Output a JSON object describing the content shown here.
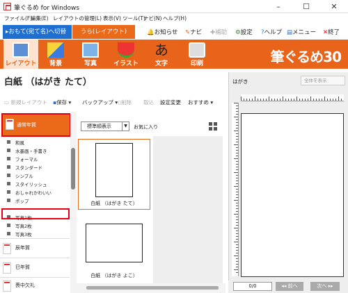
{
  "window": {
    "title": "筆ぐるめ for Windows",
    "minimize": "–",
    "maximize": "☐",
    "close": "✕"
  },
  "menubar": [
    "ファイル(F)",
    "編集(E)",
    "レイアウトの管理(L)",
    "表示(V)",
    "ツール(T)",
    "ナビ(N)",
    "ヘルプ(H)"
  ],
  "mode_tabs": {
    "front": "おもて(宛て名)へ切替",
    "back": "うら(レイアウト)"
  },
  "mode_right": {
    "news": "お知らせ",
    "navi": "ナビ",
    "assist": "補助",
    "settings": "設定",
    "help": "ヘルプ",
    "menu": "メニュー",
    "exit": "終了"
  },
  "categories": [
    "レイアウト",
    "背景",
    "写真",
    "イラスト",
    "文字",
    "印刷"
  ],
  "brand": "筆ぐるめ30",
  "paper_title": "白紙 （はがき たて）",
  "toolbar": {
    "new_layout": "新規レイアウト",
    "save": "保存",
    "backup": "バックアップ",
    "delete": "削除",
    "import": "取込",
    "change_settings": "設定変更",
    "recommend": "おすすめ"
  },
  "category_list": {
    "active": "通常年賀",
    "subitems": [
      "和風",
      "水墨画・手書き",
      "フォーマル",
      "スタンダード",
      "シンプル",
      "スタイリッシュ",
      "おしゃれかわいい",
      "ポップ",
      "写真1枚",
      "写真2枚",
      "写真3枚"
    ],
    "groups": [
      "辰年賀",
      "巳年賀",
      "喪中欠礼"
    ]
  },
  "gallery": {
    "view_mode": "標準順表示",
    "favorites": "お気に入り",
    "items": [
      "白紙 （はがき たて）",
      "白紙 （はがき よこ）"
    ]
  },
  "preview": {
    "label": "はがき",
    "zoom": "全体を表示",
    "page_counter": "0/0",
    "prev": "前へ",
    "next": "次へ"
  },
  "colors": {
    "accent_orange": "#e8641a",
    "blue": "#1f6fd0",
    "highlight_red": "#e40012"
  }
}
